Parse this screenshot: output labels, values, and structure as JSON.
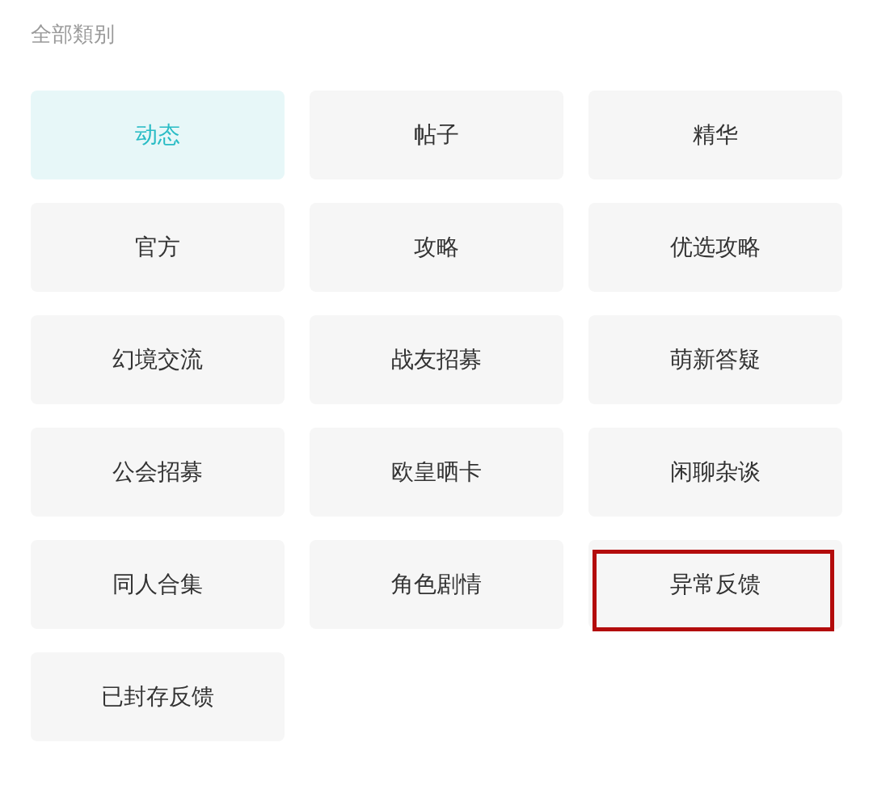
{
  "header": {
    "title": "全部類别"
  },
  "categories": [
    {
      "label": "动态",
      "selected": true,
      "highlighted": false
    },
    {
      "label": "帖子",
      "selected": false,
      "highlighted": false
    },
    {
      "label": "精华",
      "selected": false,
      "highlighted": false
    },
    {
      "label": "官方",
      "selected": false,
      "highlighted": false
    },
    {
      "label": "攻略",
      "selected": false,
      "highlighted": false
    },
    {
      "label": "优选攻略",
      "selected": false,
      "highlighted": false
    },
    {
      "label": "幻境交流",
      "selected": false,
      "highlighted": false
    },
    {
      "label": "战友招募",
      "selected": false,
      "highlighted": false
    },
    {
      "label": "萌新答疑",
      "selected": false,
      "highlighted": false
    },
    {
      "label": "公会招募",
      "selected": false,
      "highlighted": false
    },
    {
      "label": "欧皇晒卡",
      "selected": false,
      "highlighted": false
    },
    {
      "label": "闲聊杂谈",
      "selected": false,
      "highlighted": false
    },
    {
      "label": "同人合集",
      "selected": false,
      "highlighted": false
    },
    {
      "label": "角色剧情",
      "selected": false,
      "highlighted": false
    },
    {
      "label": "异常反馈",
      "selected": false,
      "highlighted": true
    },
    {
      "label": "已封存反馈",
      "selected": false,
      "highlighted": false
    }
  ]
}
